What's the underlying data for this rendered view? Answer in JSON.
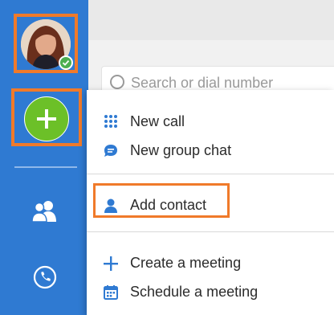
{
  "sidebar": {
    "avatar_icon": "user-avatar",
    "presence_status": "available",
    "add_icon": "plus-icon",
    "contacts_icon": "people-icon",
    "calls_icon": "phone-icon"
  },
  "search": {
    "placeholder": "Search or dial number"
  },
  "menu": {
    "new_call": "New call",
    "new_group_chat": "New group chat",
    "add_contact": "Add contact",
    "create_meeting": "Create a meeting",
    "schedule_meeting": "Schedule a meeting"
  },
  "colors": {
    "sidebar": "#2f7ad2",
    "accent_highlight": "#f07a2a",
    "add_button": "#6cc028",
    "menu_icon": "#2f7ad2"
  }
}
